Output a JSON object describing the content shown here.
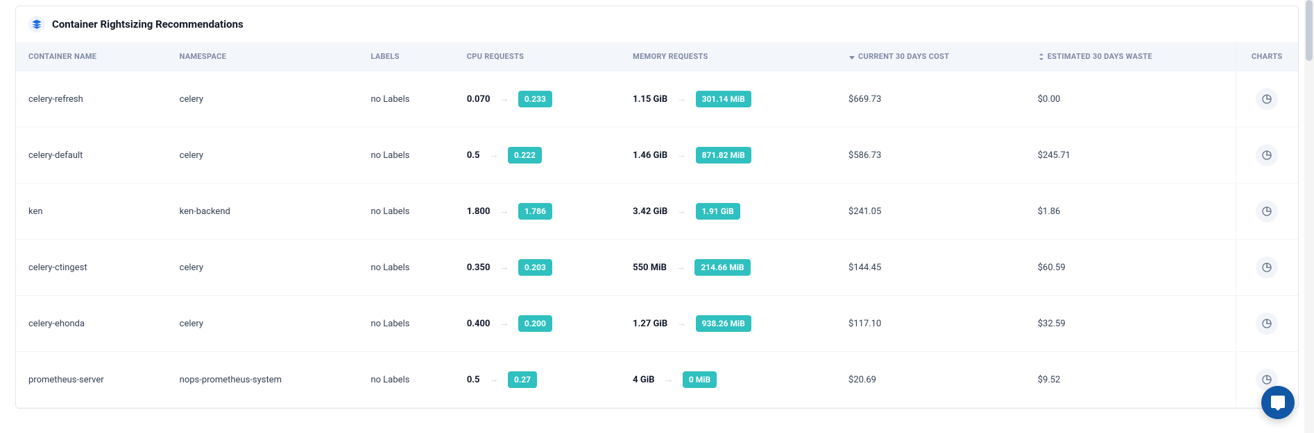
{
  "panel": {
    "title": "Container Rightsizing Recommendations"
  },
  "headers": {
    "container": "CONTAINER NAME",
    "namespace": "NAMESPACE",
    "labels": "LABELS",
    "cpu": "CPU REQUESTS",
    "memory": "MEMORY REQUESTS",
    "cost": "CURRENT 30 DAYS COST",
    "waste": "ESTIMATED 30 DAYS WASTE",
    "charts": "CHARTS"
  },
  "rows": [
    {
      "container": "celery-refresh",
      "namespace": "celery",
      "labels": "no Labels",
      "cpu_cur": "0.070",
      "cpu_rec": "0.233",
      "mem_cur": "1.15 GiB",
      "mem_rec": "301.14 MiB",
      "cost": "$669.73",
      "waste": "$0.00"
    },
    {
      "container": "celery-default",
      "namespace": "celery",
      "labels": "no Labels",
      "cpu_cur": "0.5",
      "cpu_rec": "0.222",
      "mem_cur": "1.46 GiB",
      "mem_rec": "871.82 MiB",
      "cost": "$586.73",
      "waste": "$245.71"
    },
    {
      "container": "ken",
      "namespace": "ken-backend",
      "labels": "no Labels",
      "cpu_cur": "1.800",
      "cpu_rec": "1.786",
      "mem_cur": "3.42 GiB",
      "mem_rec": "1.91 GiB",
      "cost": "$241.05",
      "waste": "$1.86"
    },
    {
      "container": "celery-ctingest",
      "namespace": "celery",
      "labels": "no Labels",
      "cpu_cur": "0.350",
      "cpu_rec": "0.203",
      "mem_cur": "550 MiB",
      "mem_rec": "214.66 MiB",
      "cost": "$144.45",
      "waste": "$60.59"
    },
    {
      "container": "celery-ehonda",
      "namespace": "celery",
      "labels": "no Labels",
      "cpu_cur": "0.400",
      "cpu_rec": "0.200",
      "mem_cur": "1.27 GiB",
      "mem_rec": "938.26 MiB",
      "cost": "$117.10",
      "waste": "$32.59"
    },
    {
      "container": "prometheus-server",
      "namespace": "nops-prometheus-system",
      "labels": "no Labels",
      "cpu_cur": "0.5",
      "cpu_rec": "0.27",
      "mem_cur": "4 GiB",
      "mem_rec": "0 MiB",
      "cost": "$20.69",
      "waste": "$9.52"
    }
  ]
}
